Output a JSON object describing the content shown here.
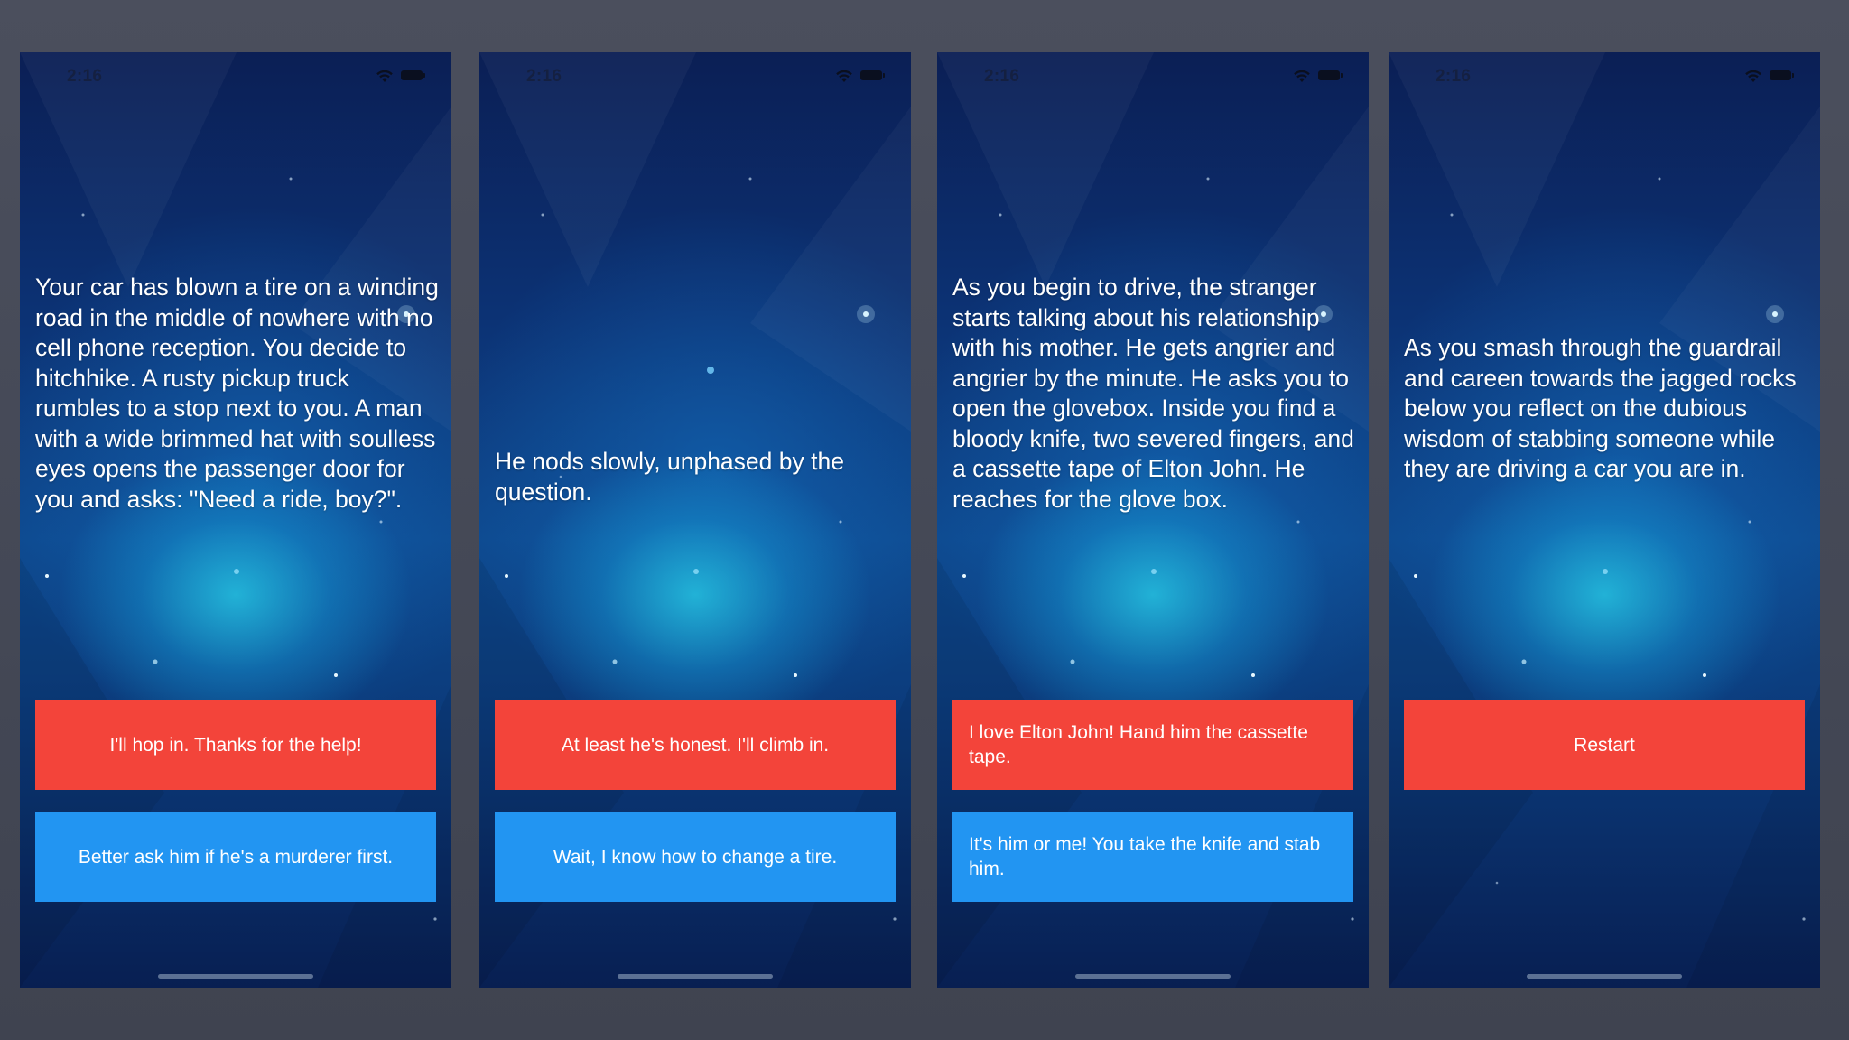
{
  "screens": [
    {
      "time": "2:16",
      "story": "Your car has blown a tire on a winding road in the middle of nowhere with no cell phone reception. You decide to hitchhike. A rusty pickup truck rumbles to a stop next to you. A man with a wide brimmed hat with soulless eyes opens the passenger door for you and asks: \"Need a ride, boy?\".",
      "choice1": "I'll hop in. Thanks for the help!",
      "choice2": "Better ask him if he's a murderer first."
    },
    {
      "time": "2:16",
      "story": "He nods slowly, unphased by the question.",
      "choice1": "At least he's honest. I'll climb in.",
      "choice2": "Wait, I know how to change a tire."
    },
    {
      "time": "2:16",
      "story": "As you begin to drive, the stranger starts talking about his relationship with his mother. He gets angrier and angrier by the minute. He asks you to open the glovebox. Inside you find a bloody knife, two severed fingers, and a cassette tape of Elton John. He reaches for the glove box.",
      "choice1": "I love Elton John! Hand him the cassette tape.",
      "choice2": "It's him or me! You take the knife and stab him."
    },
    {
      "time": "2:16",
      "story": "As you smash through the guardrail and careen towards the jagged rocks below you reflect on the dubious wisdom of stabbing someone while they are driving a car you are in.",
      "choice1": "Restart"
    }
  ],
  "colors": {
    "choice1": "#f3443a",
    "choice2": "#2295f2",
    "backdrop": "#474b58"
  },
  "icons": [
    "wifi-icon",
    "battery-icon"
  ]
}
